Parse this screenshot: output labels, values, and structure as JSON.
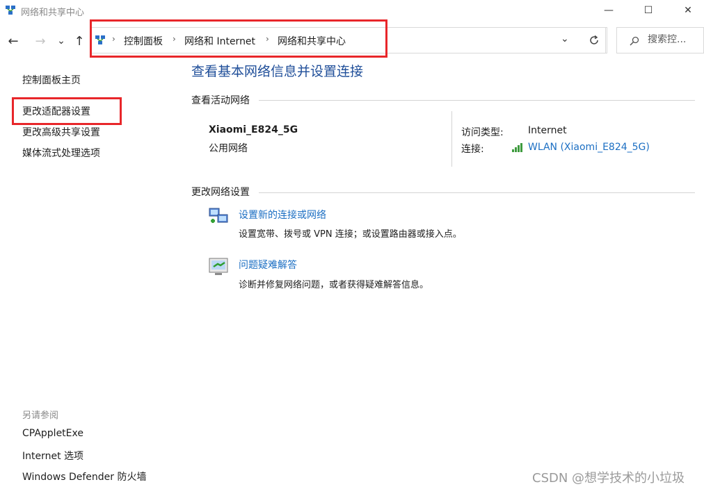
{
  "window": {
    "title": "网络和共享中心",
    "caption": {
      "minimize": "—",
      "maximize": "☐",
      "close": "✕"
    }
  },
  "nav": {
    "back": "←",
    "forward": "→",
    "recent": "⌄",
    "up": "↑"
  },
  "address": {
    "crumbs": [
      "控制面板",
      "网络和 Internet",
      "网络和共享中心"
    ],
    "separator": "›",
    "dropdown": "⌄"
  },
  "search": {
    "placeholder": "搜索控..."
  },
  "left_pane": {
    "links": [
      "控制面板主页",
      "更改适配器设置",
      "更改高级共享设置",
      "媒体流式处理选项"
    ],
    "see_also_heading": "另请参阅",
    "see_also": [
      "CPAppletExe",
      "Internet 选项",
      "Windows Defender 防火墙"
    ]
  },
  "main": {
    "title": "查看基本网络信息并设置连接",
    "active_heading": "查看活动网络",
    "network": {
      "name": "Xiaomi_E824_5G",
      "category": "公用网络",
      "access_label": "访问类型:",
      "access_value": "Internet",
      "conn_label": "连接:",
      "conn_value": "WLAN (Xiaomi_E824_5G)"
    },
    "change_heading": "更改网络设置",
    "tasks": [
      {
        "title": "设置新的连接或网络",
        "desc": "设置宽带、拨号或 VPN 连接；或设置路由器或接入点。"
      },
      {
        "title": "问题疑难解答",
        "desc": "诊断并修复网络问题，或者获得疑难解答信息。"
      }
    ]
  },
  "watermark": "CSDN @想学技术的小垃圾",
  "colors": {
    "link": "#1c6fc3",
    "title": "#1f4e99",
    "highlight": "#e8262a"
  }
}
